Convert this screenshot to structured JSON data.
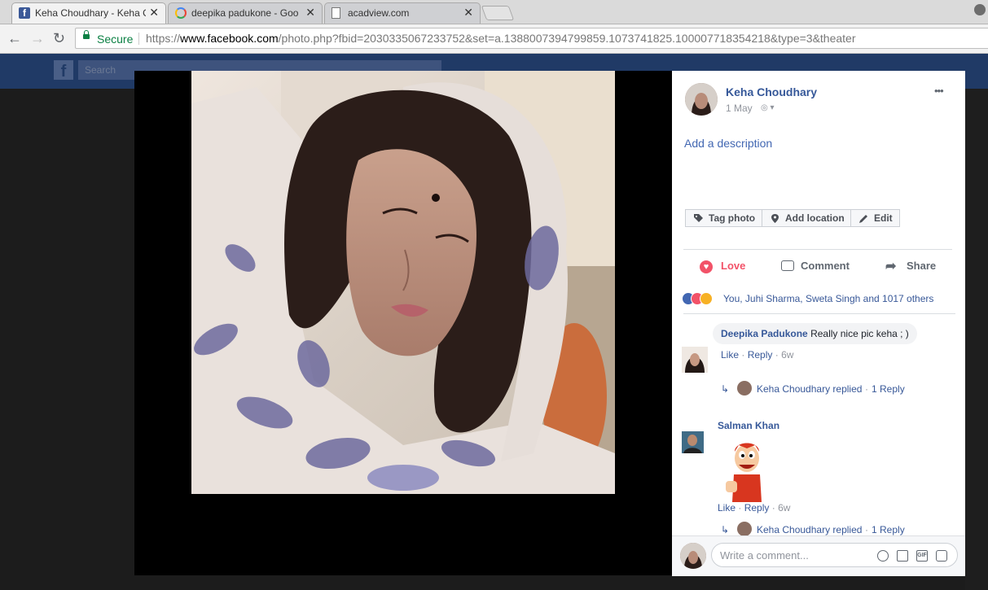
{
  "browser": {
    "tabs": [
      {
        "title": "Keha Choudhary - Keha C",
        "close": "✕",
        "icon": "facebook-icon",
        "active": true
      },
      {
        "title": "deepika padukone - Goo",
        "close": "✕",
        "icon": "google-icon",
        "active": false
      },
      {
        "title": "acadview.com",
        "close": "✕",
        "icon": "document-icon",
        "active": false
      }
    ],
    "secure_label": "Secure",
    "url_scheme": "https://",
    "url_host": "www.facebook.com",
    "url_rest": "/photo.php?fbid=2030335067233752&set=a.1388007394799859.1073741825.100007718354218&type=3&theater"
  },
  "facebook_bar": {
    "logo": "f",
    "search_placeholder": "Search"
  },
  "post": {
    "author": "Keha Choudhary",
    "date": "1 May",
    "more": "•••",
    "add_description": "Add a description",
    "buttons": {
      "tag": "Tag photo",
      "location": "Add location",
      "edit": "Edit"
    },
    "actions": {
      "love": "Love",
      "comment": "Comment",
      "share": "Share"
    },
    "reactions_text": "You, Juhi Sharma, Sweta Singh and 1017 others"
  },
  "comments": [
    {
      "author": "Deepika Padukone",
      "text": "Really nice pic keha ; )",
      "like": "Like",
      "reply": "Reply",
      "age": "6w",
      "reply_summary": {
        "author": "Keha Choudhary replied",
        "sep": "·",
        "count": "1 Reply"
      }
    },
    {
      "author": "Salman Khan",
      "text": "",
      "sticker": "cartoon-thumbs-up-sticker",
      "like": "Like",
      "reply": "Reply",
      "age": "6w",
      "reply_summary": {
        "author": "Keha Choudhary replied",
        "sep": "·",
        "count": "1 Reply"
      }
    }
  ],
  "composer": {
    "placeholder": "Write a comment..."
  },
  "colors": {
    "facebook_blue": "#3b5998",
    "link": "#365899",
    "love_red": "#f25268",
    "secure_green": "#0b8043"
  }
}
